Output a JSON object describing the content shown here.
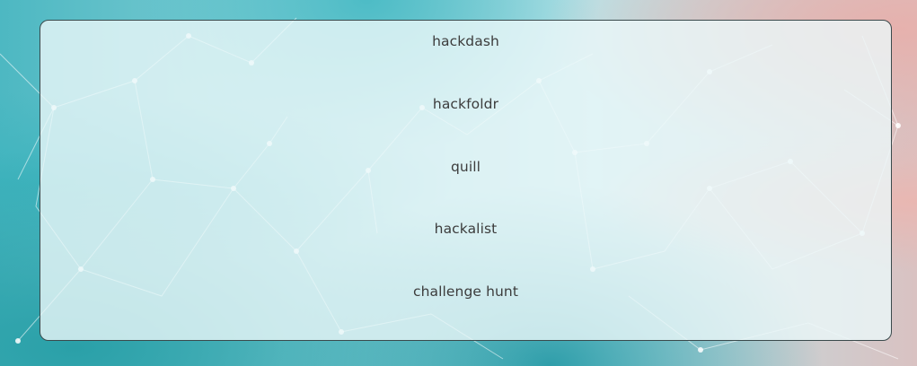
{
  "menu": {
    "items": [
      {
        "label": "hackdash"
      },
      {
        "label": "hackfoldr"
      },
      {
        "label": "quill"
      },
      {
        "label": "hackalist"
      },
      {
        "label": "challenge hunt"
      }
    ]
  }
}
